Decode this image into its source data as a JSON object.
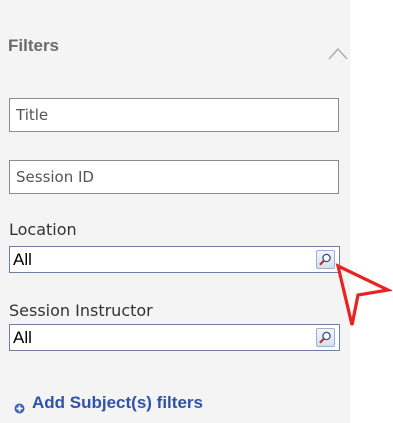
{
  "filters": {
    "title": "Filters",
    "title_field": {
      "placeholder": "Title",
      "value": ""
    },
    "session_id_field": {
      "placeholder": "Session ID",
      "value": ""
    },
    "location": {
      "label": "Location",
      "value": "All"
    },
    "session_instructor": {
      "label": "Session Instructor",
      "value": "All"
    },
    "add_subject_filters": "Add Subject(s) filters"
  },
  "icons": {
    "collapse": "chevron-up-icon",
    "lookup": "lookup-icon",
    "add": "add-circle-icon",
    "annotation": "pointer-arrow-icon"
  },
  "colors": {
    "panel_background": "#f4f4f4",
    "link_blue": "#2f53a8",
    "annotation_red": "#e8231f"
  }
}
